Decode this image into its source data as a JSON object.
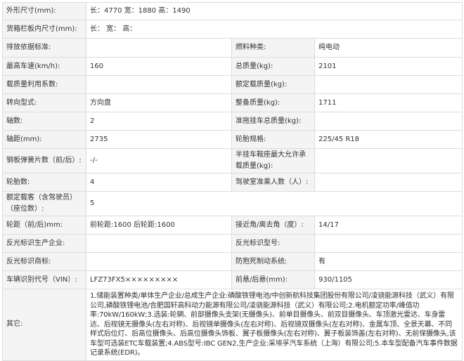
{
  "spec_table": {
    "rows": [
      {
        "type": "wide",
        "label": "外形尺寸(mm):",
        "value": "长：4770 宽：1880 高：1490"
      },
      {
        "type": "wide",
        "label": "货箱栏板内尺寸(mm):",
        "value": "长： 宽： 高："
      },
      {
        "type": "pair",
        "label1": "排放依据标准:",
        "value1": "",
        "label2": "燃料种类:",
        "value2": "纯电动"
      },
      {
        "type": "pair",
        "label1": "最高车速(km/h):",
        "value1": "160",
        "label2": "总质量(kg):",
        "value2": "2101"
      },
      {
        "type": "pair",
        "label1": "载质量利用系数:",
        "value1": "",
        "label2": "额定载质量(kg):",
        "value2": ""
      },
      {
        "type": "pair",
        "label1": "转向型式:",
        "value1": "方向盘",
        "label2": "整备质量(kg):",
        "value2": "1711"
      },
      {
        "type": "pair",
        "label1": "轴数:",
        "value1": "2",
        "label2": "准拖挂车总质量(kg):",
        "value2": ""
      },
      {
        "type": "pair",
        "label1": "轴距(mm):",
        "value1": "2735",
        "label2": "轮胎规格:",
        "value2": "225/45 R18"
      },
      {
        "type": "pair",
        "label1": "钢板弹簧片数（前/后）:",
        "value1": "-/-",
        "label2": "半挂车鞍座最大允许承载质量(kg):",
        "value2": ""
      },
      {
        "type": "pair",
        "label1": "轮胎数:",
        "value1": "4",
        "label2": "驾驶室准乘人数（人）:",
        "value2": ""
      },
      {
        "type": "wide",
        "label": "额定载客（含驾驶员）（座位数）:",
        "value": "5"
      },
      {
        "type": "pair",
        "label1": "轮距（前/后)mm:",
        "value1": "前轮距:1600 后轮距:1600",
        "label2": "接近角/离去角（度）:",
        "value2": "14/17"
      },
      {
        "type": "pair",
        "label1": "反光标识生产企业:",
        "value1": "",
        "label2": "反光标识型号:",
        "value2": ""
      },
      {
        "type": "pair",
        "label1": "反光标识商标:",
        "value1": "",
        "label2": "防抱死制动系统:",
        "value2": "有"
      },
      {
        "type": "pair",
        "label1": "车辆识别代号（VIN）:",
        "value1": "LFZ73FX5×××××××××",
        "label2": "前悬/后悬(mm):",
        "value2": "930/1105"
      },
      {
        "type": "notes",
        "label": "其它:",
        "value": "1.储能装置种类/单体生产企业/总成生产企业:磷酸铁锂电池/中创新航科技集团股份有限公司/凌骁能源科技（武义）有限公司,磷酸铁锂电池/合肥国轩高科动力能源有限公司/凌骁能源科技（武义）有限公司;2.电机额定功率/峰值功率:70kW/160kW;3.选装:轮辋、前部摄像头支架(无摄像头)、前单目摄像头、前双目摄像头、车顶激光雷达、车身雷达、后视镜无摄像头(左右对称)、后视镜单摄像头(左右对称)、后视镜双摄像头(左右对称)、金属车顶、全景天幕、不同样式后位灯、后高位摄像头、后高位摄像头饰板、翼子板摄像头(左右对称)、翼子板装饰盖(左右对称)、无前保摄像头,该车型可选装ETC车载装置;4.ABS型号:IBC GEN2,生产企业:采埃孚汽车系统（上海）有限公司;5.本车型配备汽车事件数据记录系统(EDR)。"
      }
    ]
  }
}
